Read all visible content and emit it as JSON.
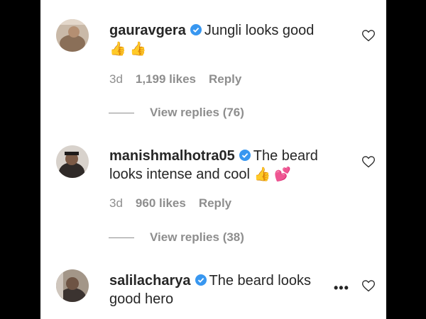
{
  "comments": [
    {
      "username": "gauravgera",
      "text": "Jungli looks good",
      "emojis": "👍 👍",
      "time": "3d",
      "likes": "1,199 likes",
      "reply": "Reply",
      "view_replies": "View replies (76)"
    },
    {
      "username": "manishmalhotra05",
      "text": "The beard looks intense and cool",
      "emojis": "👍 💕",
      "time": "3d",
      "likes": "960 likes",
      "reply": "Reply",
      "view_replies": "View replies (38)"
    },
    {
      "username": "salilacharya",
      "text": "The beard looks good hero",
      "more": "•••"
    }
  ],
  "icons": {
    "verified": "verified-badge-icon",
    "like": "heart-outline-icon"
  },
  "colors": {
    "verified": "#3897f0",
    "text": "#262626",
    "secondary": "#8e8e8e"
  }
}
